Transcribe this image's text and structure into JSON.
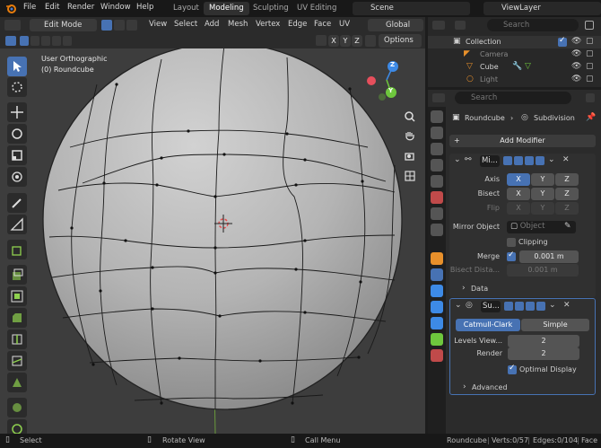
{
  "topbar": {
    "menus": [
      "File",
      "Edit",
      "Render",
      "Window",
      "Help"
    ],
    "workspaces": [
      "Layout",
      "Modeling",
      "Sculpting",
      "UV Editing"
    ],
    "active_workspace": "Modeling",
    "scene": "Scene",
    "view_layer": "ViewLayer"
  },
  "viewport_header": {
    "mode": "Edit Mode",
    "menus": [
      "View",
      "Select",
      "Add",
      "Mesh",
      "Vertex",
      "Edge",
      "Face",
      "UV"
    ],
    "orientation": "Global",
    "options": "Options",
    "axes": [
      "X",
      "Y",
      "Z"
    ]
  },
  "viewport": {
    "view_name": "User Orthographic",
    "object_label": "(0) Roundcube",
    "gizmo": {
      "x": "X",
      "y": "Y",
      "z": "Z"
    }
  },
  "outliner": {
    "search_placeholder": "Search",
    "items": [
      {
        "label": "Collection"
      },
      {
        "label": "Camera"
      },
      {
        "label": "Cube"
      },
      {
        "label": "Light"
      }
    ]
  },
  "properties": {
    "search_placeholder": "Search",
    "breadcrumb_object": "Roundcube",
    "breadcrumb_modifier": "Subdivision",
    "add_modifier": "Add Modifier",
    "mirror": {
      "name": "Mi...",
      "axis_label": "Axis",
      "bisect_label": "Bisect",
      "flip_label": "Flip",
      "axes": [
        "X",
        "Y",
        "Z"
      ],
      "mirror_object_label": "Mirror Object",
      "mirror_object_placeholder": "Object",
      "clipping_label": "Clipping",
      "merge_label": "Merge",
      "merge_value": "0.001 m",
      "bisect_distance_label": "Bisect Dista...",
      "bisect_distance_value": "0.001 m",
      "data_label": "Data"
    },
    "subdivision": {
      "name": "Su...",
      "catmull_clark": "Catmull-Clark",
      "simple": "Simple",
      "levels_viewport_label": "Levels View...",
      "levels_viewport_value": "2",
      "render_label": "Render",
      "render_value": "2",
      "optimal_display_label": "Optimal Display",
      "advanced_label": "Advanced"
    }
  },
  "statusbar": {
    "select": "Select",
    "rotate_view": "Rotate View",
    "call_menu": "Call Menu",
    "object": "Roundcube",
    "verts": "Verts:0/57",
    "edges": "Edges:0/104",
    "faces": "Face"
  },
  "colors": {
    "accent": "#4772b3",
    "x_axis": "#e64f5c",
    "y_axis": "#6ec73d",
    "z_axis": "#3d8ae6"
  }
}
